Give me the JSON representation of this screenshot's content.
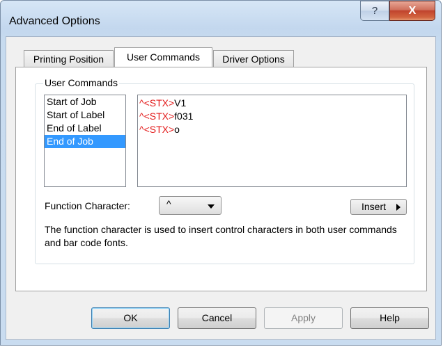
{
  "window": {
    "title": "Advanced Options",
    "help_glyph": "?",
    "close_glyph": "X"
  },
  "tabs": [
    {
      "label": "Printing Position"
    },
    {
      "label": "User Commands"
    },
    {
      "label": "Driver Options"
    }
  ],
  "active_tab": "User Commands",
  "group": {
    "legend": "User Commands"
  },
  "list": {
    "items": [
      {
        "label": "Start of Job"
      },
      {
        "label": "Start of Label"
      },
      {
        "label": "End of Label"
      },
      {
        "label": "End of Job"
      }
    ],
    "selected": "End of Job"
  },
  "editor": {
    "lines": [
      {
        "prefix": "^<STX>",
        "text": "V1"
      },
      {
        "prefix": "^<STX>",
        "text": "f031"
      },
      {
        "prefix": "^<STX>",
        "text": "o"
      }
    ]
  },
  "function_char": {
    "label": "Function Character:",
    "value": "^"
  },
  "insert_button": {
    "label": "Insert"
  },
  "description": "The function character is used to insert control characters in both user commands and bar code fonts.",
  "buttons": {
    "ok": "OK",
    "cancel": "Cancel",
    "apply": "Apply",
    "help": "Help"
  },
  "colors": {
    "selection": "#3399ff",
    "command_prefix": "#e31a1a",
    "close_button": "#c8452f"
  }
}
